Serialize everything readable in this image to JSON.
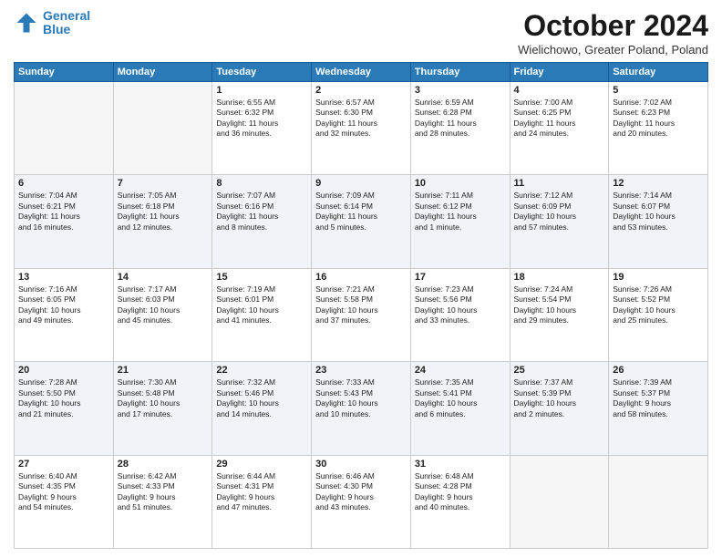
{
  "logo": {
    "line1": "General",
    "line2": "Blue"
  },
  "title": "October 2024",
  "location": "Wielichowo, Greater Poland, Poland",
  "days_of_week": [
    "Sunday",
    "Monday",
    "Tuesday",
    "Wednesday",
    "Thursday",
    "Friday",
    "Saturday"
  ],
  "weeks": [
    [
      {
        "day": "",
        "text": ""
      },
      {
        "day": "",
        "text": ""
      },
      {
        "day": "1",
        "text": "Sunrise: 6:55 AM\nSunset: 6:32 PM\nDaylight: 11 hours\nand 36 minutes."
      },
      {
        "day": "2",
        "text": "Sunrise: 6:57 AM\nSunset: 6:30 PM\nDaylight: 11 hours\nand 32 minutes."
      },
      {
        "day": "3",
        "text": "Sunrise: 6:59 AM\nSunset: 6:28 PM\nDaylight: 11 hours\nand 28 minutes."
      },
      {
        "day": "4",
        "text": "Sunrise: 7:00 AM\nSunset: 6:25 PM\nDaylight: 11 hours\nand 24 minutes."
      },
      {
        "day": "5",
        "text": "Sunrise: 7:02 AM\nSunset: 6:23 PM\nDaylight: 11 hours\nand 20 minutes."
      }
    ],
    [
      {
        "day": "6",
        "text": "Sunrise: 7:04 AM\nSunset: 6:21 PM\nDaylight: 11 hours\nand 16 minutes."
      },
      {
        "day": "7",
        "text": "Sunrise: 7:05 AM\nSunset: 6:18 PM\nDaylight: 11 hours\nand 12 minutes."
      },
      {
        "day": "8",
        "text": "Sunrise: 7:07 AM\nSunset: 6:16 PM\nDaylight: 11 hours\nand 8 minutes."
      },
      {
        "day": "9",
        "text": "Sunrise: 7:09 AM\nSunset: 6:14 PM\nDaylight: 11 hours\nand 5 minutes."
      },
      {
        "day": "10",
        "text": "Sunrise: 7:11 AM\nSunset: 6:12 PM\nDaylight: 11 hours\nand 1 minute."
      },
      {
        "day": "11",
        "text": "Sunrise: 7:12 AM\nSunset: 6:09 PM\nDaylight: 10 hours\nand 57 minutes."
      },
      {
        "day": "12",
        "text": "Sunrise: 7:14 AM\nSunset: 6:07 PM\nDaylight: 10 hours\nand 53 minutes."
      }
    ],
    [
      {
        "day": "13",
        "text": "Sunrise: 7:16 AM\nSunset: 6:05 PM\nDaylight: 10 hours\nand 49 minutes."
      },
      {
        "day": "14",
        "text": "Sunrise: 7:17 AM\nSunset: 6:03 PM\nDaylight: 10 hours\nand 45 minutes."
      },
      {
        "day": "15",
        "text": "Sunrise: 7:19 AM\nSunset: 6:01 PM\nDaylight: 10 hours\nand 41 minutes."
      },
      {
        "day": "16",
        "text": "Sunrise: 7:21 AM\nSunset: 5:58 PM\nDaylight: 10 hours\nand 37 minutes."
      },
      {
        "day": "17",
        "text": "Sunrise: 7:23 AM\nSunset: 5:56 PM\nDaylight: 10 hours\nand 33 minutes."
      },
      {
        "day": "18",
        "text": "Sunrise: 7:24 AM\nSunset: 5:54 PM\nDaylight: 10 hours\nand 29 minutes."
      },
      {
        "day": "19",
        "text": "Sunrise: 7:26 AM\nSunset: 5:52 PM\nDaylight: 10 hours\nand 25 minutes."
      }
    ],
    [
      {
        "day": "20",
        "text": "Sunrise: 7:28 AM\nSunset: 5:50 PM\nDaylight: 10 hours\nand 21 minutes."
      },
      {
        "day": "21",
        "text": "Sunrise: 7:30 AM\nSunset: 5:48 PM\nDaylight: 10 hours\nand 17 minutes."
      },
      {
        "day": "22",
        "text": "Sunrise: 7:32 AM\nSunset: 5:46 PM\nDaylight: 10 hours\nand 14 minutes."
      },
      {
        "day": "23",
        "text": "Sunrise: 7:33 AM\nSunset: 5:43 PM\nDaylight: 10 hours\nand 10 minutes."
      },
      {
        "day": "24",
        "text": "Sunrise: 7:35 AM\nSunset: 5:41 PM\nDaylight: 10 hours\nand 6 minutes."
      },
      {
        "day": "25",
        "text": "Sunrise: 7:37 AM\nSunset: 5:39 PM\nDaylight: 10 hours\nand 2 minutes."
      },
      {
        "day": "26",
        "text": "Sunrise: 7:39 AM\nSunset: 5:37 PM\nDaylight: 9 hours\nand 58 minutes."
      }
    ],
    [
      {
        "day": "27",
        "text": "Sunrise: 6:40 AM\nSunset: 4:35 PM\nDaylight: 9 hours\nand 54 minutes."
      },
      {
        "day": "28",
        "text": "Sunrise: 6:42 AM\nSunset: 4:33 PM\nDaylight: 9 hours\nand 51 minutes."
      },
      {
        "day": "29",
        "text": "Sunrise: 6:44 AM\nSunset: 4:31 PM\nDaylight: 9 hours\nand 47 minutes."
      },
      {
        "day": "30",
        "text": "Sunrise: 6:46 AM\nSunset: 4:30 PM\nDaylight: 9 hours\nand 43 minutes."
      },
      {
        "day": "31",
        "text": "Sunrise: 6:48 AM\nSunset: 4:28 PM\nDaylight: 9 hours\nand 40 minutes."
      },
      {
        "day": "",
        "text": ""
      },
      {
        "day": "",
        "text": ""
      }
    ]
  ]
}
